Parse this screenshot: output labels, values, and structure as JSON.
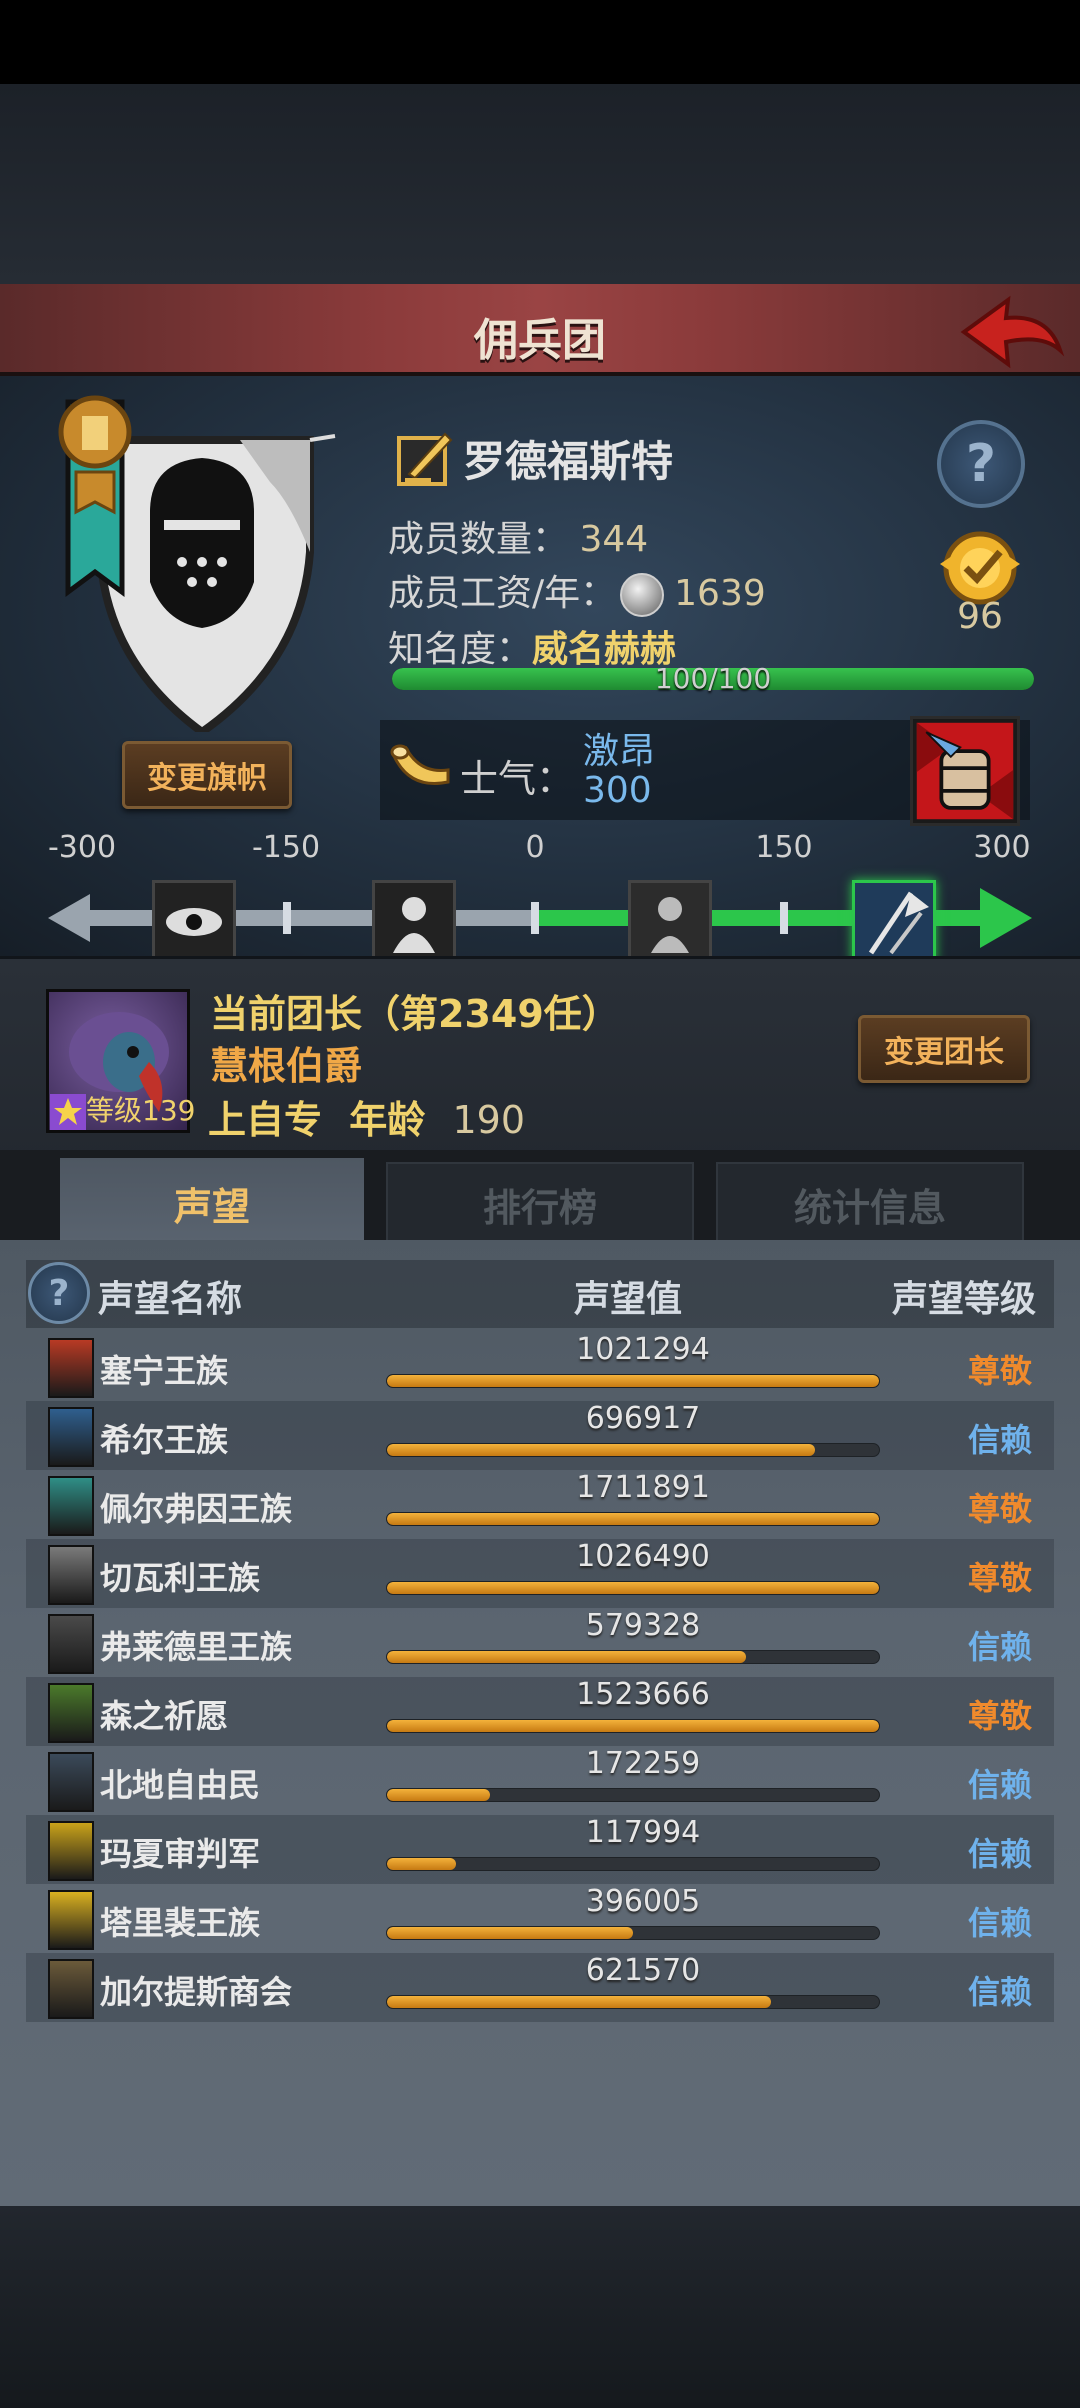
{
  "window": {
    "title": "佣兵团"
  },
  "guild": {
    "name": "罗德福斯特",
    "member_count_label": "成员数量：",
    "member_count": "344",
    "wage_label": "成员工资/年：",
    "wage": "1639",
    "fame_label": "知名度：",
    "fame_value": "威名赫赫",
    "fame_progress_text": "100/100",
    "fame_progress": 1.0,
    "rank_number": "96",
    "change_banner_label": "变更旗帜"
  },
  "morale": {
    "label": "士气：",
    "state": "激昂",
    "value": "300",
    "track_ticks": [
      "-300",
      "-150",
      "0",
      "150",
      "300"
    ],
    "position_value": 300
  },
  "leader": {
    "title": "当前团长（第2349任）",
    "name": "慧根伯爵",
    "level_label": "等级",
    "level": "139",
    "info_trait": "上自专",
    "age_label": "年龄",
    "age": "190",
    "change_leader_label": "变更团长"
  },
  "tabs": [
    {
      "label": "声望",
      "active": true
    },
    {
      "label": "排行榜",
      "active": false
    },
    {
      "label": "统计信息",
      "active": false
    }
  ],
  "reputation": {
    "headers": {
      "name": "声望名称",
      "value": "声望值",
      "level": "声望等级"
    },
    "rows": [
      {
        "name": "塞宁王族",
        "value": "1021294",
        "fill": 1.0,
        "level": "尊敬",
        "icon": "red-crest-icon",
        "icon_color": "#b83a24"
      },
      {
        "name": "希尔王族",
        "value": "696917",
        "fill": 0.87,
        "level": "信赖",
        "icon": "blue-crest-icon",
        "icon_color": "#2f5f8e"
      },
      {
        "name": "佩尔弗因王族",
        "value": "1711891",
        "fill": 1.0,
        "level": "尊敬",
        "icon": "teal-crest-icon",
        "icon_color": "#2f8e86"
      },
      {
        "name": "切瓦利王族",
        "value": "1026490",
        "fill": 1.0,
        "level": "尊敬",
        "icon": "scales-crest-icon",
        "icon_color": "#7a7a7a"
      },
      {
        "name": "弗莱德里王族",
        "value": "579328",
        "fill": 0.73,
        "level": "信赖",
        "icon": "skull-crest-icon",
        "icon_color": "#4a4a4a"
      },
      {
        "name": "森之祈愿",
        "value": "1523666",
        "fill": 1.0,
        "level": "尊敬",
        "icon": "tree-crest-icon",
        "icon_color": "#4b7a2b"
      },
      {
        "name": "北地自由民",
        "value": "172259",
        "fill": 0.21,
        "level": "信赖",
        "icon": "axe-crest-icon",
        "icon_color": "#3b4a5a"
      },
      {
        "name": "玛夏审判军",
        "value": "117994",
        "fill": 0.14,
        "level": "信赖",
        "icon": "sun-crest-icon",
        "icon_color": "#c9a21a"
      },
      {
        "name": "塔里裴王族",
        "value": "396005",
        "fill": 0.5,
        "level": "信赖",
        "icon": "crown-crest-icon",
        "icon_color": "#d9b020"
      },
      {
        "name": "加尔提斯商会",
        "value": "621570",
        "fill": 0.78,
        "level": "信赖",
        "icon": "chest-crest-icon",
        "icon_color": "#6b5a3a"
      }
    ],
    "level_colors": {
      "尊敬": "#f08a2c",
      "信赖": "#6fb2ec"
    }
  },
  "colors": {
    "accent_gold": "#f0d26c",
    "fame_green": "#37c24e",
    "rep_orange": "#f4b23b"
  }
}
